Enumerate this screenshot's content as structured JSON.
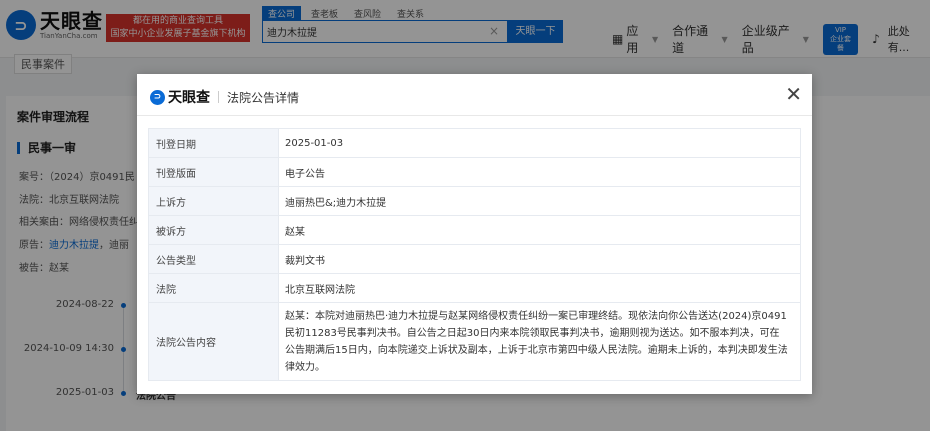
{
  "header": {
    "logo_cn": "天眼查",
    "logo_en": "TianYanCha.com",
    "slogan_line1": "都在用的商业查询工具",
    "slogan_line2": "国家中小企业发展子基金旗下机构",
    "tabs": [
      "查公司",
      "查老板",
      "查风险",
      "查关系"
    ],
    "search_value": "迪力木拉提",
    "clear_icon": "close-icon",
    "search_button": "天眼一下",
    "nav": {
      "app": "应用",
      "channel": "合作通道",
      "enterprise": "企业级产品",
      "vip_line1": "VIP",
      "vip_line2": "企业套餐",
      "user": "此处有..."
    }
  },
  "background": {
    "tag": "民事案件",
    "section_title": "案件审理流程",
    "stage_title": "民事一审",
    "case_no": "案号：（2024）京0491民",
    "court": "法院：北京互联网法院",
    "related": "相关案由：网络侵权责任纠",
    "plaintiff_label": "原告：",
    "plaintiff_link": "迪力木拉提",
    "plaintiff_rest": "，迪丽",
    "defendant": "被告：赵某",
    "timeline": [
      "2024-08-22",
      "2024-10-09 14:30",
      "2025-01-03"
    ],
    "timeline_last_text": "法院公告"
  },
  "modal": {
    "logo_text": "天眼查",
    "title": "法院公告详情",
    "close_icon": "close-icon",
    "rows": [
      {
        "label": "刊登日期",
        "value": "2025-01-03"
      },
      {
        "label": "刊登版面",
        "value": "电子公告"
      },
      {
        "label": "上诉方",
        "value": "迪丽热巴&;迪力木拉提"
      },
      {
        "label": "被诉方",
        "value": "赵某"
      },
      {
        "label": "公告类型",
        "value": "裁判文书"
      },
      {
        "label": "法院",
        "value": "北京互联网法院"
      },
      {
        "label": "法院公告内容",
        "value": "赵某：本院对迪丽热巴·迪力木拉提与赵某网络侵权责任纠纷一案已审理终结。现依法向你公告送达(2024)京0491民初11283号民事判决书。自公告之日起30日内来本院领取民事判决书，逾期则视为送达。如不服本判决，可在公告期满后15日内，向本院递交上诉状及副本，上诉于北京市第四中级人民法院。逾期未上诉的，本判决即发生法律效力。"
      }
    ]
  }
}
